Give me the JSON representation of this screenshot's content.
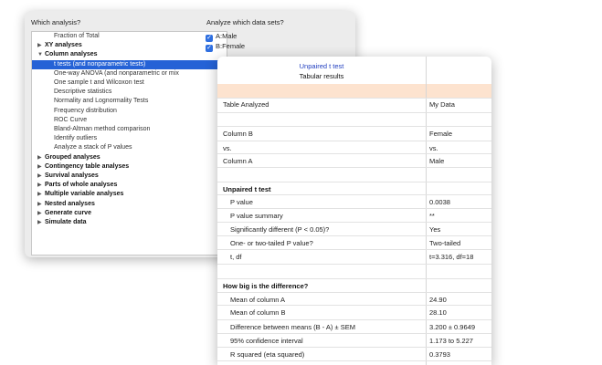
{
  "dialog": {
    "which_label": "Which analysis?",
    "datasets_label": "Analyze which data sets?",
    "tree": [
      {
        "label": "Fraction of Total",
        "level": "child"
      },
      {
        "label": "XY analyses",
        "level": "top",
        "expanded": false
      },
      {
        "label": "Column analyses",
        "level": "top",
        "expanded": true
      },
      {
        "label": "t tests (and nonparametric tests)",
        "level": "child",
        "selected": true
      },
      {
        "label": "One-way ANOVA (and nonparametric or mix",
        "level": "child"
      },
      {
        "label": "One sample t and Wilcoxon test",
        "level": "child"
      },
      {
        "label": "Descriptive statistics",
        "level": "child"
      },
      {
        "label": "Normality and Lognormality Tests",
        "level": "child"
      },
      {
        "label": "Frequency distribution",
        "level": "child"
      },
      {
        "label": "ROC Curve",
        "level": "child"
      },
      {
        "label": "Bland-Altman method comparison",
        "level": "child"
      },
      {
        "label": "Identify outliers",
        "level": "child"
      },
      {
        "label": "Analyze a stack of P values",
        "level": "child"
      },
      {
        "label": "Grouped analyses",
        "level": "top",
        "expanded": false
      },
      {
        "label": "Contingency table analyses",
        "level": "top",
        "expanded": false
      },
      {
        "label": "Survival analyses",
        "level": "top",
        "expanded": false
      },
      {
        "label": "Parts of whole analyses",
        "level": "top",
        "expanded": false
      },
      {
        "label": "Multiple variable analyses",
        "level": "top",
        "expanded": false
      },
      {
        "label": "Nested analyses",
        "level": "top",
        "expanded": false
      },
      {
        "label": "Generate curve",
        "level": "top",
        "expanded": false
      },
      {
        "label": "Simulate data",
        "level": "top",
        "expanded": false
      }
    ],
    "datasets": [
      {
        "label": "A:Male",
        "checked": true
      },
      {
        "label": "B:Female",
        "checked": true
      }
    ]
  },
  "results": {
    "title": "Unpaired t test",
    "subtitle": "Tabular results",
    "rows": [
      {
        "label": "Table Analyzed",
        "value": "My Data"
      },
      {
        "label": "Column B",
        "value": "Female"
      },
      {
        "label": "vs.",
        "value": "vs."
      },
      {
        "label": "Column A",
        "value": "Male"
      },
      {
        "label": "Unpaired t test",
        "value": "",
        "bold": true
      },
      {
        "label": "P value",
        "value": "0.0038",
        "indent": true
      },
      {
        "label": "P value summary",
        "value": "**",
        "indent": true
      },
      {
        "label": "Significantly different (P < 0.05)?",
        "value": "Yes",
        "indent": true
      },
      {
        "label": "One- or two-tailed P value?",
        "value": "Two-tailed",
        "indent": true
      },
      {
        "label": "t, df",
        "value": "t=3.316, df=18",
        "indent": true
      },
      {
        "label": "How big is the difference?",
        "value": "",
        "bold": true
      },
      {
        "label": "Mean of column A",
        "value": "24.90",
        "indent": true
      },
      {
        "label": "Mean of column B",
        "value": "28.10",
        "indent": true
      },
      {
        "label": "Difference between means (B - A) ± SEM",
        "value": "3.200 ± 0.9649",
        "indent": true
      },
      {
        "label": "95% confidence interval",
        "value": "1.173 to 5.227",
        "indent": true
      },
      {
        "label": "R squared (eta squared)",
        "value": "0.3793",
        "indent": true
      }
    ]
  }
}
